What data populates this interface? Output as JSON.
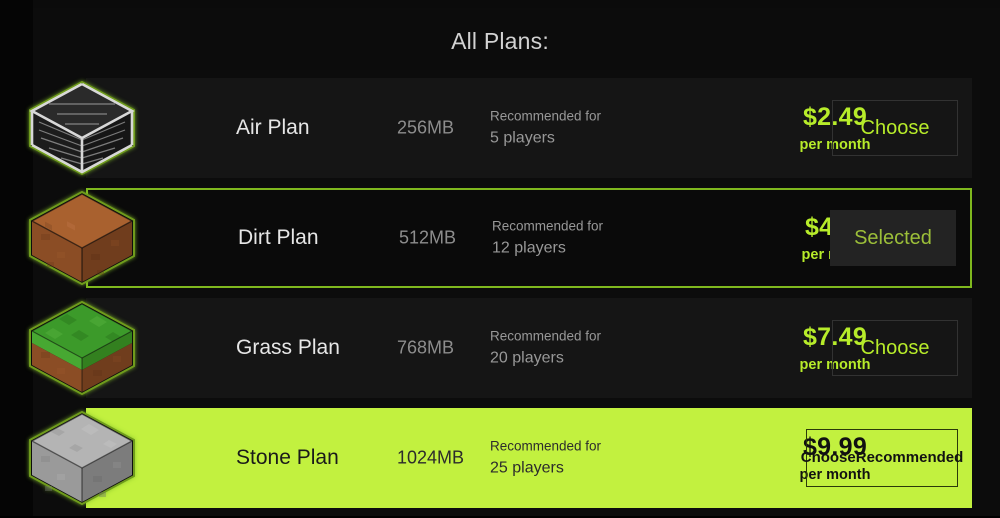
{
  "header": {
    "title": "All Plans:"
  },
  "colors": {
    "accent_green": "#b7ec2a",
    "recommended_bg": "#c2f13f",
    "selected_border": "#7fb81e",
    "row_bg": "#151515",
    "page_bg": "#0c0c0c"
  },
  "plans": [
    {
      "icon": "air-block-icon",
      "name": "Air Plan",
      "ram": "256MB",
      "recommended_for_label": "Recommended for",
      "players": "5 players",
      "price": "$2.49",
      "period": "per month",
      "button_label": "Choose",
      "state": "default"
    },
    {
      "icon": "dirt-block-icon",
      "name": "Dirt Plan",
      "ram": "512MB",
      "recommended_for_label": "Recommended for",
      "players": "12 players",
      "price": "$4.99",
      "period": "per month",
      "button_label": "Selected",
      "state": "selected"
    },
    {
      "icon": "grass-block-icon",
      "name": "Grass Plan",
      "ram": "768MB",
      "recommended_for_label": "Recommended for",
      "players": "20 players",
      "price": "$7.49",
      "period": "per month",
      "button_label": "Choose",
      "state": "default"
    },
    {
      "icon": "stone-block-icon",
      "name": "Stone Plan",
      "ram": "1024MB",
      "recommended_for_label": "Recommended for",
      "players": "25 players",
      "price": "$9.99",
      "period": "per month",
      "button_label": "Choose Recommended",
      "button_line1": "Choose",
      "button_line2": "Recommended",
      "state": "recommended"
    }
  ]
}
